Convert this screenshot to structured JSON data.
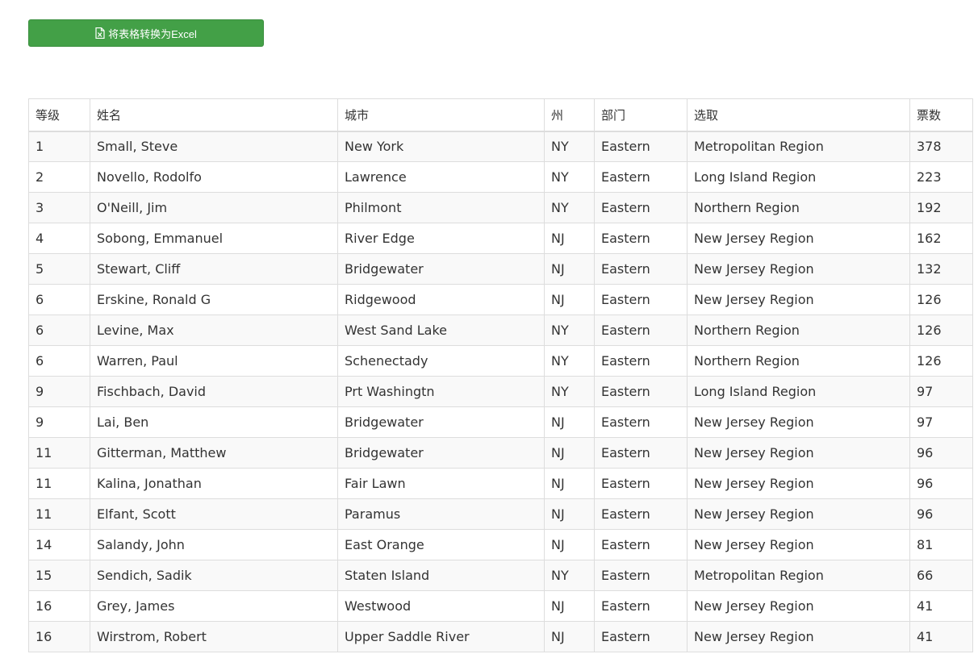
{
  "toolbar": {
    "export_label": "将表格转换为Excel",
    "export_icon": "file-excel-icon",
    "accent_color": "#43a047"
  },
  "table": {
    "columns": [
      "等级",
      "姓名",
      "城市",
      "州",
      "部门",
      "选取",
      "票数"
    ],
    "rows": [
      [
        "1",
        "Small, Steve",
        "New York",
        "NY",
        "Eastern",
        "Metropolitan Region",
        "378"
      ],
      [
        "2",
        "Novello, Rodolfo",
        "Lawrence",
        "NY",
        "Eastern",
        "Long Island Region",
        "223"
      ],
      [
        "3",
        "O'Neill, Jim",
        "Philmont",
        "NY",
        "Eastern",
        "Northern Region",
        "192"
      ],
      [
        "4",
        "Sobong, Emmanuel",
        "River Edge",
        "NJ",
        "Eastern",
        "New Jersey Region",
        "162"
      ],
      [
        "5",
        "Stewart, Cliff",
        "Bridgewater",
        "NJ",
        "Eastern",
        "New Jersey Region",
        "132"
      ],
      [
        "6",
        "Erskine, Ronald G",
        "Ridgewood",
        "NJ",
        "Eastern",
        "New Jersey Region",
        "126"
      ],
      [
        "6",
        "Levine, Max",
        "West Sand Lake",
        "NY",
        "Eastern",
        "Northern Region",
        "126"
      ],
      [
        "6",
        "Warren, Paul",
        "Schenectady",
        "NY",
        "Eastern",
        "Northern Region",
        "126"
      ],
      [
        "9",
        "Fischbach, David",
        "Prt Washingtn",
        "NY",
        "Eastern",
        "Long Island Region",
        "97"
      ],
      [
        "9",
        "Lai, Ben",
        "Bridgewater",
        "NJ",
        "Eastern",
        "New Jersey Region",
        "97"
      ],
      [
        "11",
        "Gitterman, Matthew",
        "Bridgewater",
        "NJ",
        "Eastern",
        "New Jersey Region",
        "96"
      ],
      [
        "11",
        "Kalina, Jonathan",
        "Fair Lawn",
        "NJ",
        "Eastern",
        "New Jersey Region",
        "96"
      ],
      [
        "11",
        "Elfant, Scott",
        "Paramus",
        "NJ",
        "Eastern",
        "New Jersey Region",
        "96"
      ],
      [
        "14",
        "Salandy, John",
        "East Orange",
        "NJ",
        "Eastern",
        "New Jersey Region",
        "81"
      ],
      [
        "15",
        "Sendich, Sadik",
        "Staten Island",
        "NY",
        "Eastern",
        "Metropolitan Region",
        "66"
      ],
      [
        "16",
        "Grey, James",
        "Westwood",
        "NJ",
        "Eastern",
        "New Jersey Region",
        "41"
      ],
      [
        "16",
        "Wirstrom, Robert",
        "Upper Saddle River",
        "NJ",
        "Eastern",
        "New Jersey Region",
        "41"
      ]
    ]
  }
}
